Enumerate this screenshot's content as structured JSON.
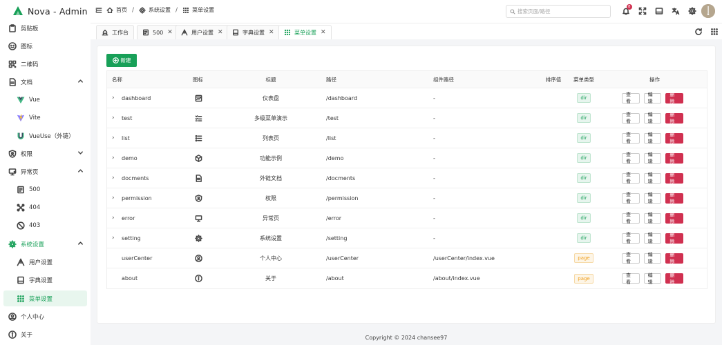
{
  "app": {
    "title": "Nova - Admin"
  },
  "sidebar": {
    "items": [
      {
        "label": "剪贴板",
        "icon": "clipboard-icon"
      },
      {
        "label": "图标",
        "icon": "emoji-icon"
      },
      {
        "label": "二维码",
        "icon": "qrcode-icon"
      },
      {
        "label": "文档",
        "icon": "document-icon"
      },
      {
        "label": "Vue",
        "icon": "vue-logo-icon"
      },
      {
        "label": "Vite",
        "icon": "vite-logo-icon"
      },
      {
        "label": "VueUse（外链）",
        "icon": "vueuse-logo-icon"
      },
      {
        "label": "权限",
        "icon": "shield-icon"
      },
      {
        "label": "异常页",
        "icon": "monitor-icon"
      },
      {
        "label": "500",
        "icon": "server-icon"
      },
      {
        "label": "404",
        "icon": "broken-icon"
      },
      {
        "label": "403",
        "icon": "forbidden-icon"
      },
      {
        "label": "系统设置",
        "icon": "gear-icon"
      },
      {
        "label": "用户设置",
        "icon": "user-settings-icon"
      },
      {
        "label": "字典设置",
        "icon": "book-icon"
      },
      {
        "label": "菜单设置",
        "icon": "grid-icon"
      },
      {
        "label": "个人中心",
        "icon": "user-circle-icon"
      },
      {
        "label": "关于",
        "icon": "info-icon"
      }
    ]
  },
  "header": {
    "breadcrumb": [
      "首页",
      "系统设置",
      "菜单设置"
    ],
    "search_placeholder": "搜索页面/路径",
    "notification_count": "8"
  },
  "tabs": [
    {
      "label": "工作台",
      "closable": false
    },
    {
      "label": "500",
      "closable": true
    },
    {
      "label": "用户设置",
      "closable": true
    },
    {
      "label": "字典设置",
      "closable": true
    },
    {
      "label": "菜单设置",
      "closable": true
    }
  ],
  "toolbar": {
    "new_label": "新建"
  },
  "table": {
    "headers": {
      "name": "名称",
      "icon": "图标",
      "title": "标题",
      "path": "路径",
      "component": "组件路径",
      "order": "排序值",
      "type": "菜单类型",
      "ops": "操作"
    },
    "ops": {
      "view": "查看",
      "edit": "编辑",
      "delete": "删除"
    },
    "rows": [
      {
        "name": "dashboard",
        "icon": "dashboard-icon",
        "title": "仪表盘",
        "path": "/dashboard",
        "component": "-",
        "order": "",
        "type": "dir",
        "expandable": true
      },
      {
        "name": "test",
        "icon": "list-check-icon",
        "title": "多级菜单演示",
        "path": "/test",
        "component": "-",
        "order": "",
        "type": "dir",
        "expandable": true
      },
      {
        "name": "list",
        "icon": "list-icon",
        "title": "列表页",
        "path": "/list",
        "component": "-",
        "order": "",
        "type": "dir",
        "expandable": true
      },
      {
        "name": "demo",
        "icon": "cube-icon",
        "title": "功能示例",
        "path": "/demo",
        "component": "-",
        "order": "",
        "type": "dir",
        "expandable": true
      },
      {
        "name": "docments",
        "icon": "document-icon",
        "title": "外链文档",
        "path": "/docments",
        "component": "-",
        "order": "",
        "type": "dir",
        "expandable": true
      },
      {
        "name": "permission",
        "icon": "shield-icon",
        "title": "权限",
        "path": "/permission",
        "component": "-",
        "order": "",
        "type": "dir",
        "expandable": true
      },
      {
        "name": "error",
        "icon": "monitor-icon",
        "title": "异常页",
        "path": "/error",
        "component": "-",
        "order": "",
        "type": "dir",
        "expandable": true
      },
      {
        "name": "setting",
        "icon": "gear-icon",
        "title": "系统设置",
        "path": "/setting",
        "component": "-",
        "order": "",
        "type": "dir",
        "expandable": true
      },
      {
        "name": "userCenter",
        "icon": "user-circle-icon",
        "title": "个人中心",
        "path": "/userCenter",
        "component": "/userCenter/index.vue",
        "order": "",
        "type": "page",
        "expandable": false
      },
      {
        "name": "about",
        "icon": "info-icon",
        "title": "关于",
        "path": "/about",
        "component": "/about/index.vue",
        "order": "",
        "type": "page",
        "expandable": false
      }
    ]
  },
  "footer": {
    "text": "Copyright © 2024 chansee97"
  },
  "colors": {
    "primary": "#18a058",
    "danger": "#d03050",
    "warning": "#f0a020"
  }
}
